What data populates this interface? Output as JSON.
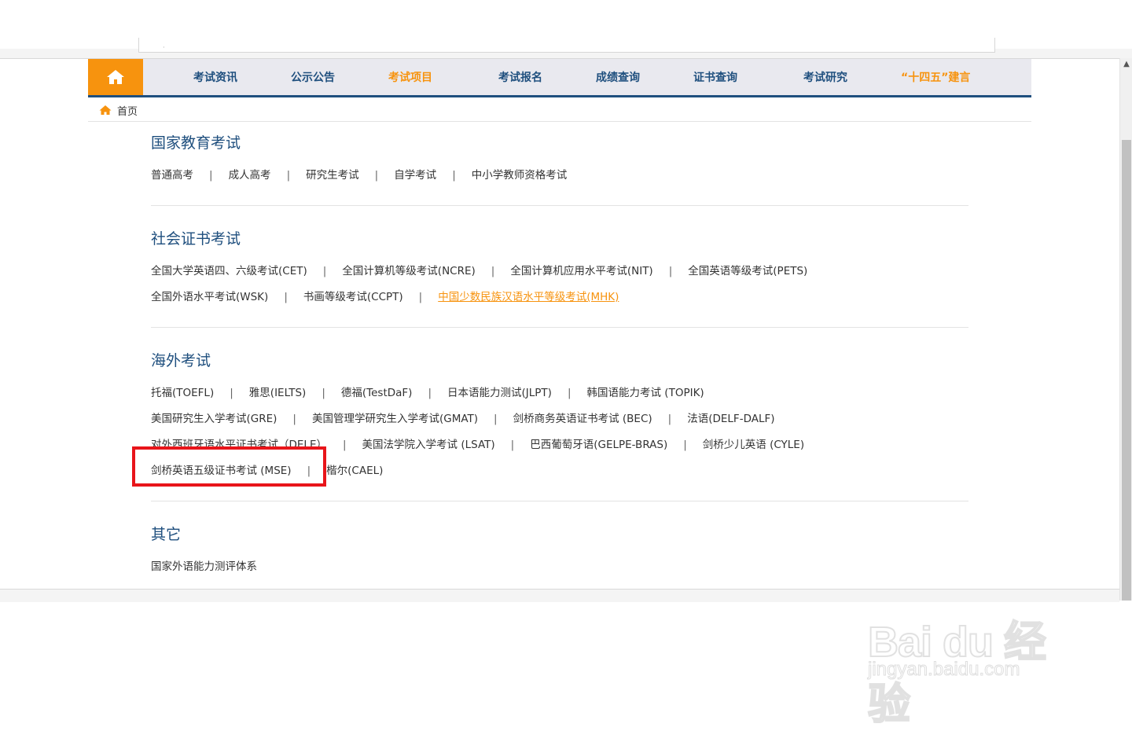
{
  "nav": {
    "items": [
      {
        "label": "考试资讯"
      },
      {
        "label": "公示公告"
      },
      {
        "label": "考试项目"
      },
      {
        "label": "考试报名"
      },
      {
        "label": "成绩查询"
      },
      {
        "label": "证书查询"
      },
      {
        "label": "考试研究"
      },
      {
        "label": "“十四五”建言"
      }
    ],
    "active_item": "考试项目"
  },
  "breadcrumb": {
    "home": "首页"
  },
  "sections": [
    {
      "title": "国家教育考试",
      "rows": [
        [
          "普通高考",
          "成人高考",
          "研究生考试",
          "自学考试",
          "中小学教师资格考试"
        ]
      ]
    },
    {
      "title": "社会证书考试",
      "rows": [
        [
          "全国大学英语四、六级考试(CET)",
          "全国计算机等级考试(NCRE)",
          "全国计算机应用水平考试(NIT)",
          "全国英语等级考试(PETS)"
        ],
        [
          "全国外语水平考试(WSK)",
          "书画等级考试(CCPT)",
          "中国少数民族汉语水平等级考试(MHK)"
        ]
      ],
      "hovered_link": "中国少数民族汉语水平等级考试(MHK)"
    },
    {
      "title": "海外考试",
      "rows": [
        [
          "托福(TOEFL)",
          "雅思(IELTS)",
          "德福(TestDaF)",
          "日本语能力测试(JLPT)",
          "韩国语能力考试 (TOPIK)"
        ],
        [
          "美国研究生入学考试(GRE)",
          "美国管理学研究生入学考试(GMAT)",
          "剑桥商务英语证书考试 (BEC)",
          "法语(DELF-DALF)"
        ],
        [
          "对外西班牙语水平证书考试（DELE）",
          "美国法学院入学考试 (LSAT)",
          "巴西葡萄牙语(GELPE-BRAS)",
          "剑桥少儿英语 (CYLE)"
        ],
        [
          "剑桥英语五级证书考试 (MSE)",
          "楷尔(CAEL)"
        ]
      ],
      "highlighted_link": "剑桥英语五级证书考试 (MSE)"
    },
    {
      "title": "其它",
      "rows": [
        [
          "国家外语能力测评体系"
        ]
      ]
    }
  ],
  "separator": "|",
  "watermark": {
    "main": "Bai du 经验",
    "sub": "jingyan.baidu.com"
  },
  "colors": {
    "nav_bg": "#e9e9ef",
    "accent_orange": "#f7930e",
    "brand_blue": "#1f4f7e",
    "highlight_red": "#e8151a"
  }
}
